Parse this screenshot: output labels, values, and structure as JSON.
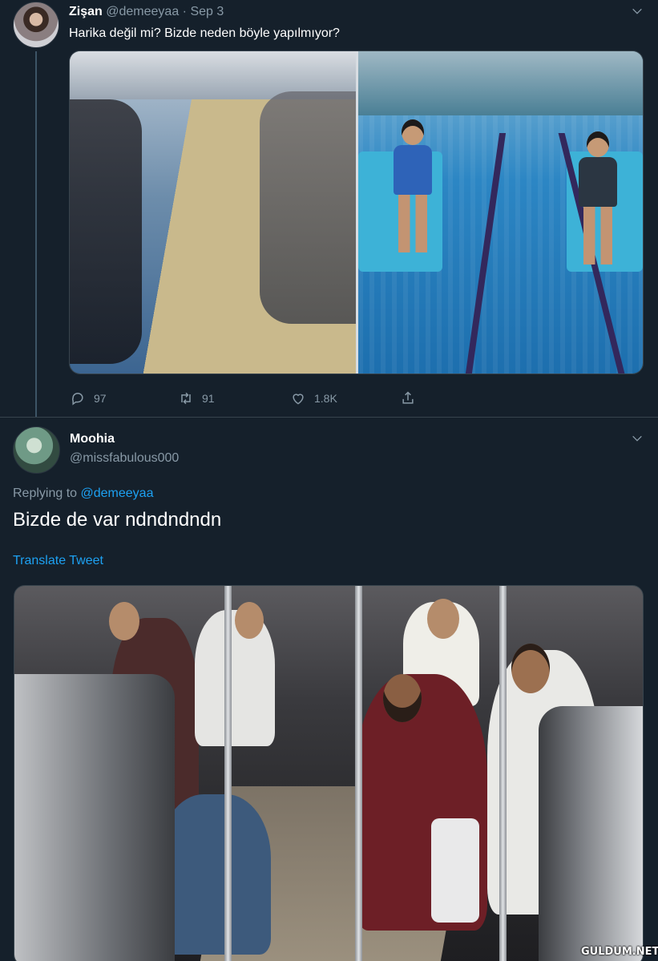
{
  "tweet1": {
    "name": "Zişan",
    "handle": "@demeeyaa",
    "separator": "·",
    "date": "Sep 3",
    "text": "Harika değil mi? Bizde neden böyle yapılmıyor?",
    "media_description": "Two photos of subway cars with floors painted like a beach and a swimming pool",
    "stats": {
      "replies": "97",
      "retweets": "91",
      "likes": "1.8K"
    },
    "icons": [
      "chevron-down-icon",
      "reply-icon",
      "retweet-icon",
      "like-icon",
      "share-icon"
    ]
  },
  "tweet2": {
    "name": "Moohia",
    "handle": "@missfabulous000",
    "replying_label": "Replying to",
    "replying_to": "@demeeyaa",
    "text": "Bizde de var ndndndndn",
    "translate": "Translate Tweet",
    "watermark": "GULDUM.NET"
  },
  "colors": {
    "background": "#15202b",
    "border": "#38444d",
    "secondary_text": "#8899a6",
    "link": "#1da1f2"
  }
}
